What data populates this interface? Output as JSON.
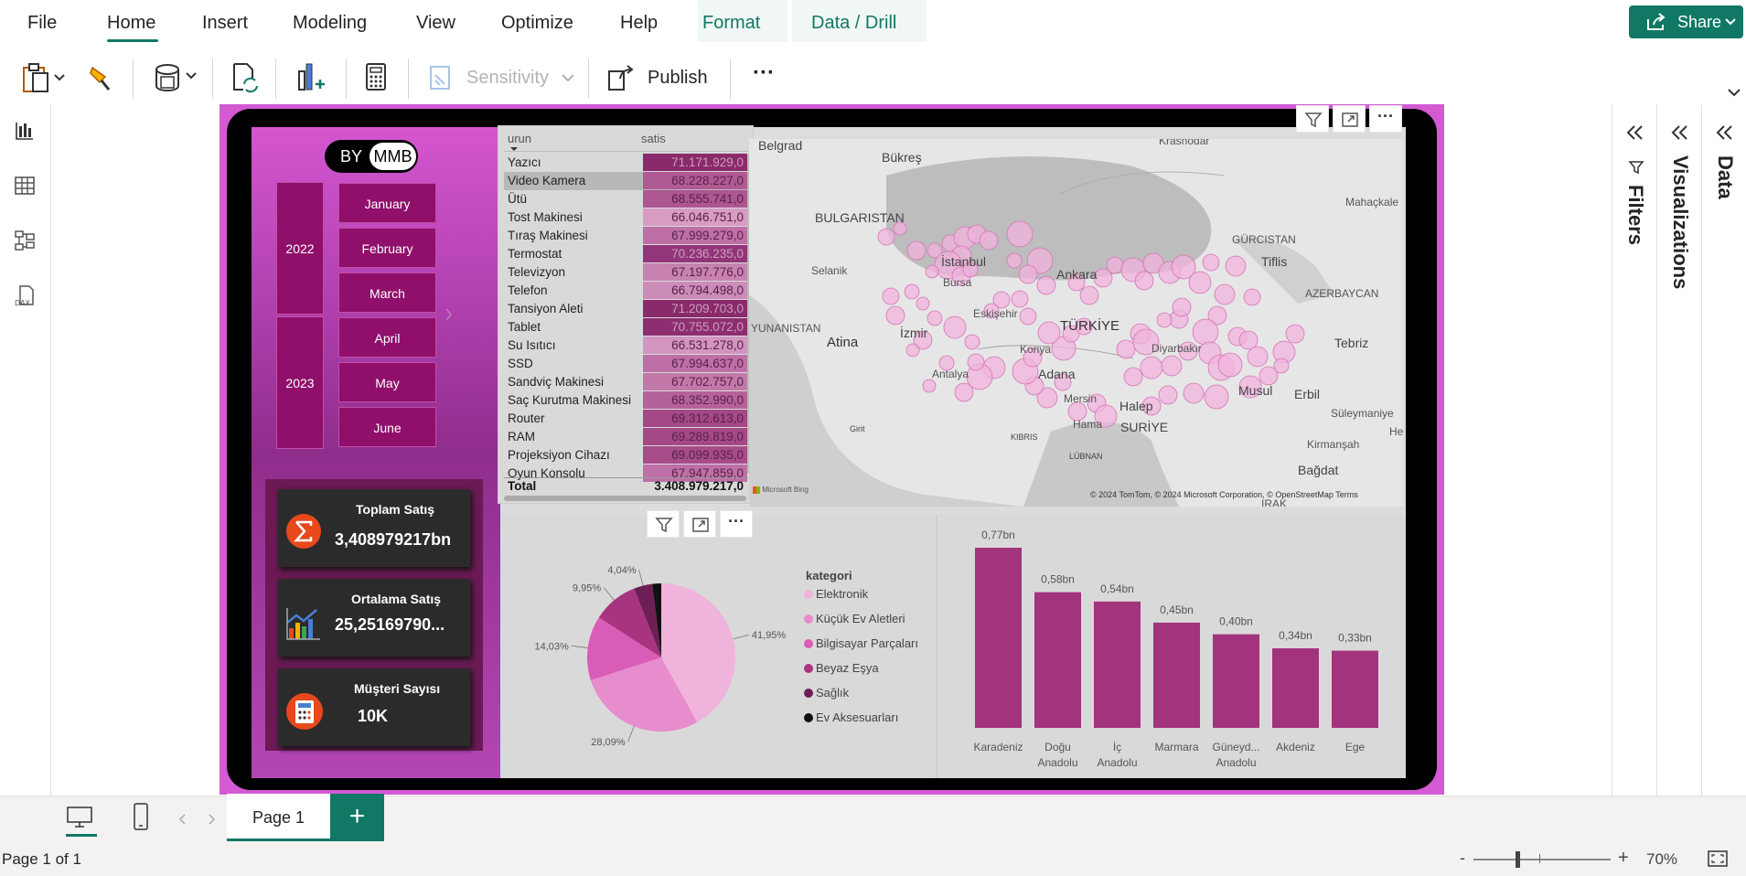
{
  "menu": {
    "items": [
      "File",
      "Home",
      "Insert",
      "Modeling",
      "View",
      "Optimize",
      "Help",
      "Format",
      "Data / Drill"
    ],
    "active": "Home",
    "share_label": "Share"
  },
  "toolbar": {
    "sensitivity_label": "Sensitivity",
    "publish_label": "Publish",
    "more_label": "···"
  },
  "slicer": {
    "toggle_left": "BY",
    "toggle_right": "MMB",
    "years": [
      "2022",
      "2023"
    ],
    "months": [
      "January",
      "February",
      "March",
      "April",
      "May",
      "June"
    ]
  },
  "kpis": [
    {
      "title": "Toplam Satış",
      "value": "3,408979217bn"
    },
    {
      "title": "Ortalama Satış",
      "value": "25,25169790..."
    },
    {
      "title": "Müşteri Sayısı",
      "value": "10K"
    }
  ],
  "table": {
    "headers": [
      "urun",
      "satis"
    ],
    "rows": [
      {
        "name": "Yazıcı",
        "value": "71.171.929,0",
        "shade": "#8a2a6b",
        "text": "#c9a0b8"
      },
      {
        "name": "Video Kamera",
        "value": "68.228.227,0",
        "shade": "#b05a93",
        "text": "#5a2148"
      },
      {
        "name": "Ütü",
        "value": "68.555.741,0",
        "shade": "#ad5690",
        "text": "#5a2148"
      },
      {
        "name": "Tost Makinesi",
        "value": "66.046.751,0",
        "shade": "#d89cc4",
        "text": "#5a2148"
      },
      {
        "name": "Tıraş Makinesi",
        "value": "67.999.279,0",
        "shade": "#be70a6",
        "text": "#5a2148"
      },
      {
        "name": "Termostat",
        "value": "70.236.235,0",
        "shade": "#93357a",
        "text": "#c9a0b8"
      },
      {
        "name": "Televizyon",
        "value": "67.197.776,0",
        "shade": "#c782b2",
        "text": "#5a2148"
      },
      {
        "name": "Telefon",
        "value": "66.794.498,0",
        "shade": "#cc8cb8",
        "text": "#5a2148"
      },
      {
        "name": "Tansiyon Aleti",
        "value": "71.209.703,0",
        "shade": "#8a2a6b",
        "text": "#c9a0b8"
      },
      {
        "name": "Tablet",
        "value": "70.755.072,0",
        "shade": "#8e2e70",
        "text": "#c9a0b8"
      },
      {
        "name": "Su Isıtıcı",
        "value": "66.531.278,0",
        "shade": "#d394c0",
        "text": "#5a2148"
      },
      {
        "name": "SSD",
        "value": "67.994.637,0",
        "shade": "#be70a6",
        "text": "#5a2148"
      },
      {
        "name": "Sandviç Makinesi",
        "value": "67.702.757,0",
        "shade": "#c279aa",
        "text": "#5a2148"
      },
      {
        "name": "Saç Kurutma Makinesi",
        "value": "68.352.990,0",
        "shade": "#b5629b",
        "text": "#5a2148"
      },
      {
        "name": "Router",
        "value": "69.312.613,0",
        "shade": "#a44886",
        "text": "#5a2148"
      },
      {
        "name": "RAM",
        "value": "69.289.819,0",
        "shade": "#a44886",
        "text": "#5a2148"
      },
      {
        "name": "Projeksiyon Cihazı",
        "value": "69.099.935,0",
        "shade": "#a74c89",
        "text": "#5a2148"
      },
      {
        "name": "Oyun Konsolu",
        "value": "67.947.859,0",
        "shade": "#be70a6",
        "text": "#5a2148"
      }
    ],
    "total_label": "Total",
    "total_value": "3.408.979.217,0"
  },
  "map": {
    "labels": [
      "Belgrad",
      "Bükreş",
      "Krasnodar",
      "BULGARISTAN",
      "GÜRCISTAN",
      "Mahaçkale",
      "İstanbul",
      "Selanik",
      "Tiflis",
      "Ankara",
      "Bursa",
      "AZERBAYCAN",
      "Eskişehir",
      "YUNANISTAN",
      "TÜRKİYE",
      "Atina",
      "İzmir",
      "Konya",
      "Tebriz",
      "Antalya",
      "Adana",
      "Diyarbakır",
      "Mersin",
      "Musul",
      "Erbil",
      "Halep",
      "SURİYE",
      "Süleymaniye",
      "Hama",
      "Hemed",
      "Girit",
      "KIBRIS",
      "Kirmanşah",
      "LÜBNAN",
      "Bağdat",
      "IRAK"
    ],
    "attribution": "© 2024 TomTom, © 2024 Microsoft Corporation, © OpenStreetMap  Terms",
    "brand": "Microsoft Bing"
  },
  "pie": {
    "legend_title": "kategori",
    "slices": [
      {
        "label": "Elektronik",
        "pct": "41,95%",
        "value": 41.95,
        "color": "#f0b3dc"
      },
      {
        "label": "Küçük Ev Aletleri",
        "pct": "28,09%",
        "value": 28.09,
        "color": "#e78ccc"
      },
      {
        "label": "Bilgisayar Parçaları",
        "pct": "14,03%",
        "value": 14.03,
        "color": "#d95cb7"
      },
      {
        "label": "Beyaz Eşya",
        "pct": "9,95%",
        "value": 9.95,
        "color": "#a8337f"
      },
      {
        "label": "Sağlık",
        "pct": "4,04%",
        "value": 4.04,
        "color": "#6d1f55"
      },
      {
        "label": "Ev Aksesuarları",
        "pct": "",
        "value": 1.94,
        "color": "#111111"
      }
    ]
  },
  "bars": {
    "chart_data": {
      "type": "bar",
      "categories": [
        "Karadeniz",
        "Doğu Anadolu",
        "İç Anadolu",
        "Marmara",
        "Güneyd... Anadolu",
        "Akdeniz",
        "Ege"
      ],
      "values": [
        0.77,
        0.58,
        0.54,
        0.45,
        0.4,
        0.34,
        0.33
      ],
      "labels": [
        "0,77bn",
        "0,58bn",
        "0,54bn",
        "0,45bn",
        "0,40bn",
        "0,34bn",
        "0,33bn"
      ],
      "color": "#a3337d"
    }
  },
  "panes": {
    "filters": "Filters",
    "visualizations": "Visualizations",
    "data": "Data"
  },
  "pages": {
    "tab_label": "Page 1",
    "add_label": "+",
    "status": "Page 1 of 1",
    "zoom": "70%"
  }
}
